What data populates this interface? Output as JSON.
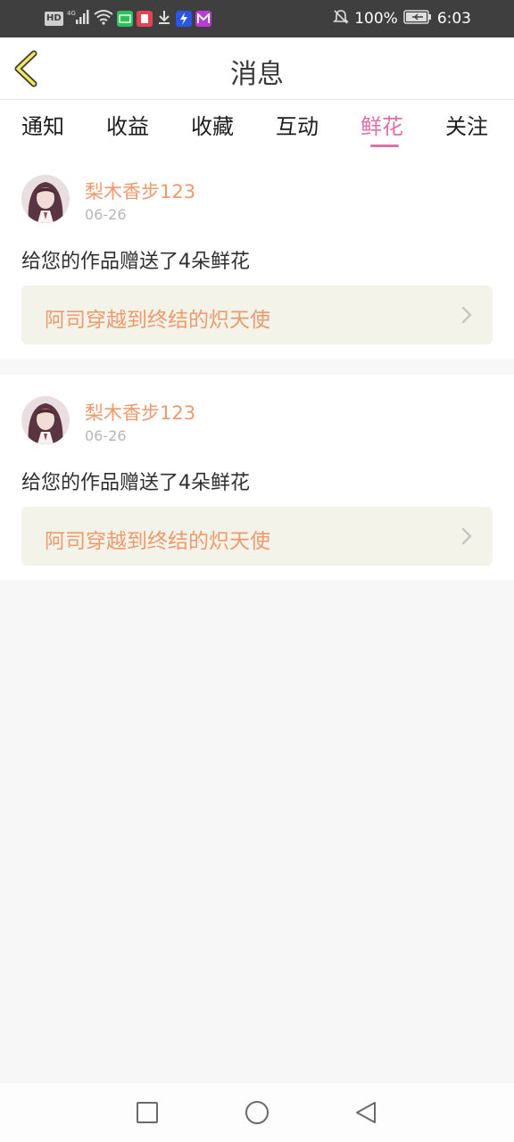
{
  "status_bar": {
    "hd": "HD",
    "signal": "4G",
    "battery": "100%",
    "time": "6:03"
  },
  "header": {
    "title": "消息"
  },
  "tabs": [
    {
      "label": "通知",
      "active": false
    },
    {
      "label": "收益",
      "active": false
    },
    {
      "label": "收藏",
      "active": false
    },
    {
      "label": "互动",
      "active": false
    },
    {
      "label": "鲜花",
      "active": true
    },
    {
      "label": "关注",
      "active": false
    }
  ],
  "messages": [
    {
      "username": "梨木香步123",
      "date": "06-26",
      "text": "给您的作品赠送了4朵鲜花",
      "work_title": "阿司穿越到终结的炽天使"
    },
    {
      "username": "梨木香步123",
      "date": "06-26",
      "text": "给您的作品赠送了4朵鲜花",
      "work_title": "阿司穿越到终结的炽天使"
    }
  ],
  "colors": {
    "accent": "#e06fa7",
    "username": "#ee9a6c",
    "work_box_bg": "#f4f3ea",
    "status_bar_bg": "#3f3f3f"
  }
}
